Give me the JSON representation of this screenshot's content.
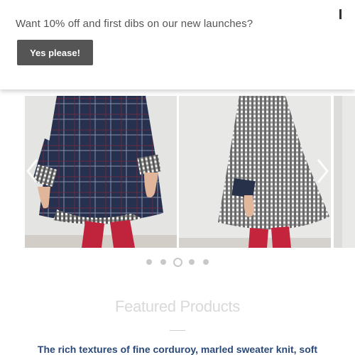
{
  "popup": {
    "message": "Want 10% off and first dibs on our new launches?",
    "button_label": "Yes please!"
  },
  "carousel": {
    "slides": [
      {
        "alt": "child in navy plaid dress with red leggings"
      },
      {
        "alt": "child in black and white gingham dress with red leggings"
      },
      {
        "alt": "next slide partial"
      }
    ],
    "dots_count": 5,
    "active_dot": 2
  },
  "featured": {
    "title": "Featured Products",
    "description": "The rich textures of fine corduroy, marled sweater knit, soft"
  },
  "colors": {
    "button_bg": "#555555",
    "title_color": "#d9d9d9",
    "description_color": "#2b4a7a"
  }
}
